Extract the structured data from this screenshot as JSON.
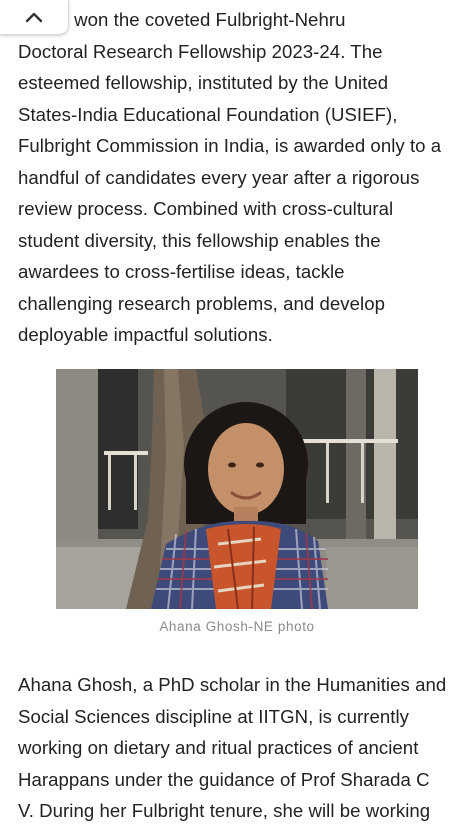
{
  "collapse_control": {
    "icon": "chevron-up-icon"
  },
  "article": {
    "paragraph_1": ", have won the coveted Fulbright-Nehru\nDoctoral Research Fellowship 2023-24. The\nesteemed fellowship, instituted by the United\nStates-India Educational Foundation (USIEF),\nFulbright Commission in India, is awarded only to a\nhandful of candidates every year after a rigorous\nreview process. Combined with cross-cultural\nstudent diversity, this fellowship enables the\nawardees to cross-fertilise ideas, tackle\nchallenging research problems, and develop\ndeployable impactful solutions.",
    "photo": {
      "caption": "Ahana Ghosh-NE photo"
    },
    "paragraph_2": "Ahana Ghosh, a PhD scholar in the Humanities and\nSocial Sciences discipline at IITGN, is currently\nworking on dietary and ritual practices of ancient\nHarappans under the guidance of Prof Sharada C\nV. During her Fulbright tenure, she will be working"
  },
  "colors": {
    "text": "#222222",
    "caption": "#8a8a8a",
    "background": "#ffffff"
  }
}
